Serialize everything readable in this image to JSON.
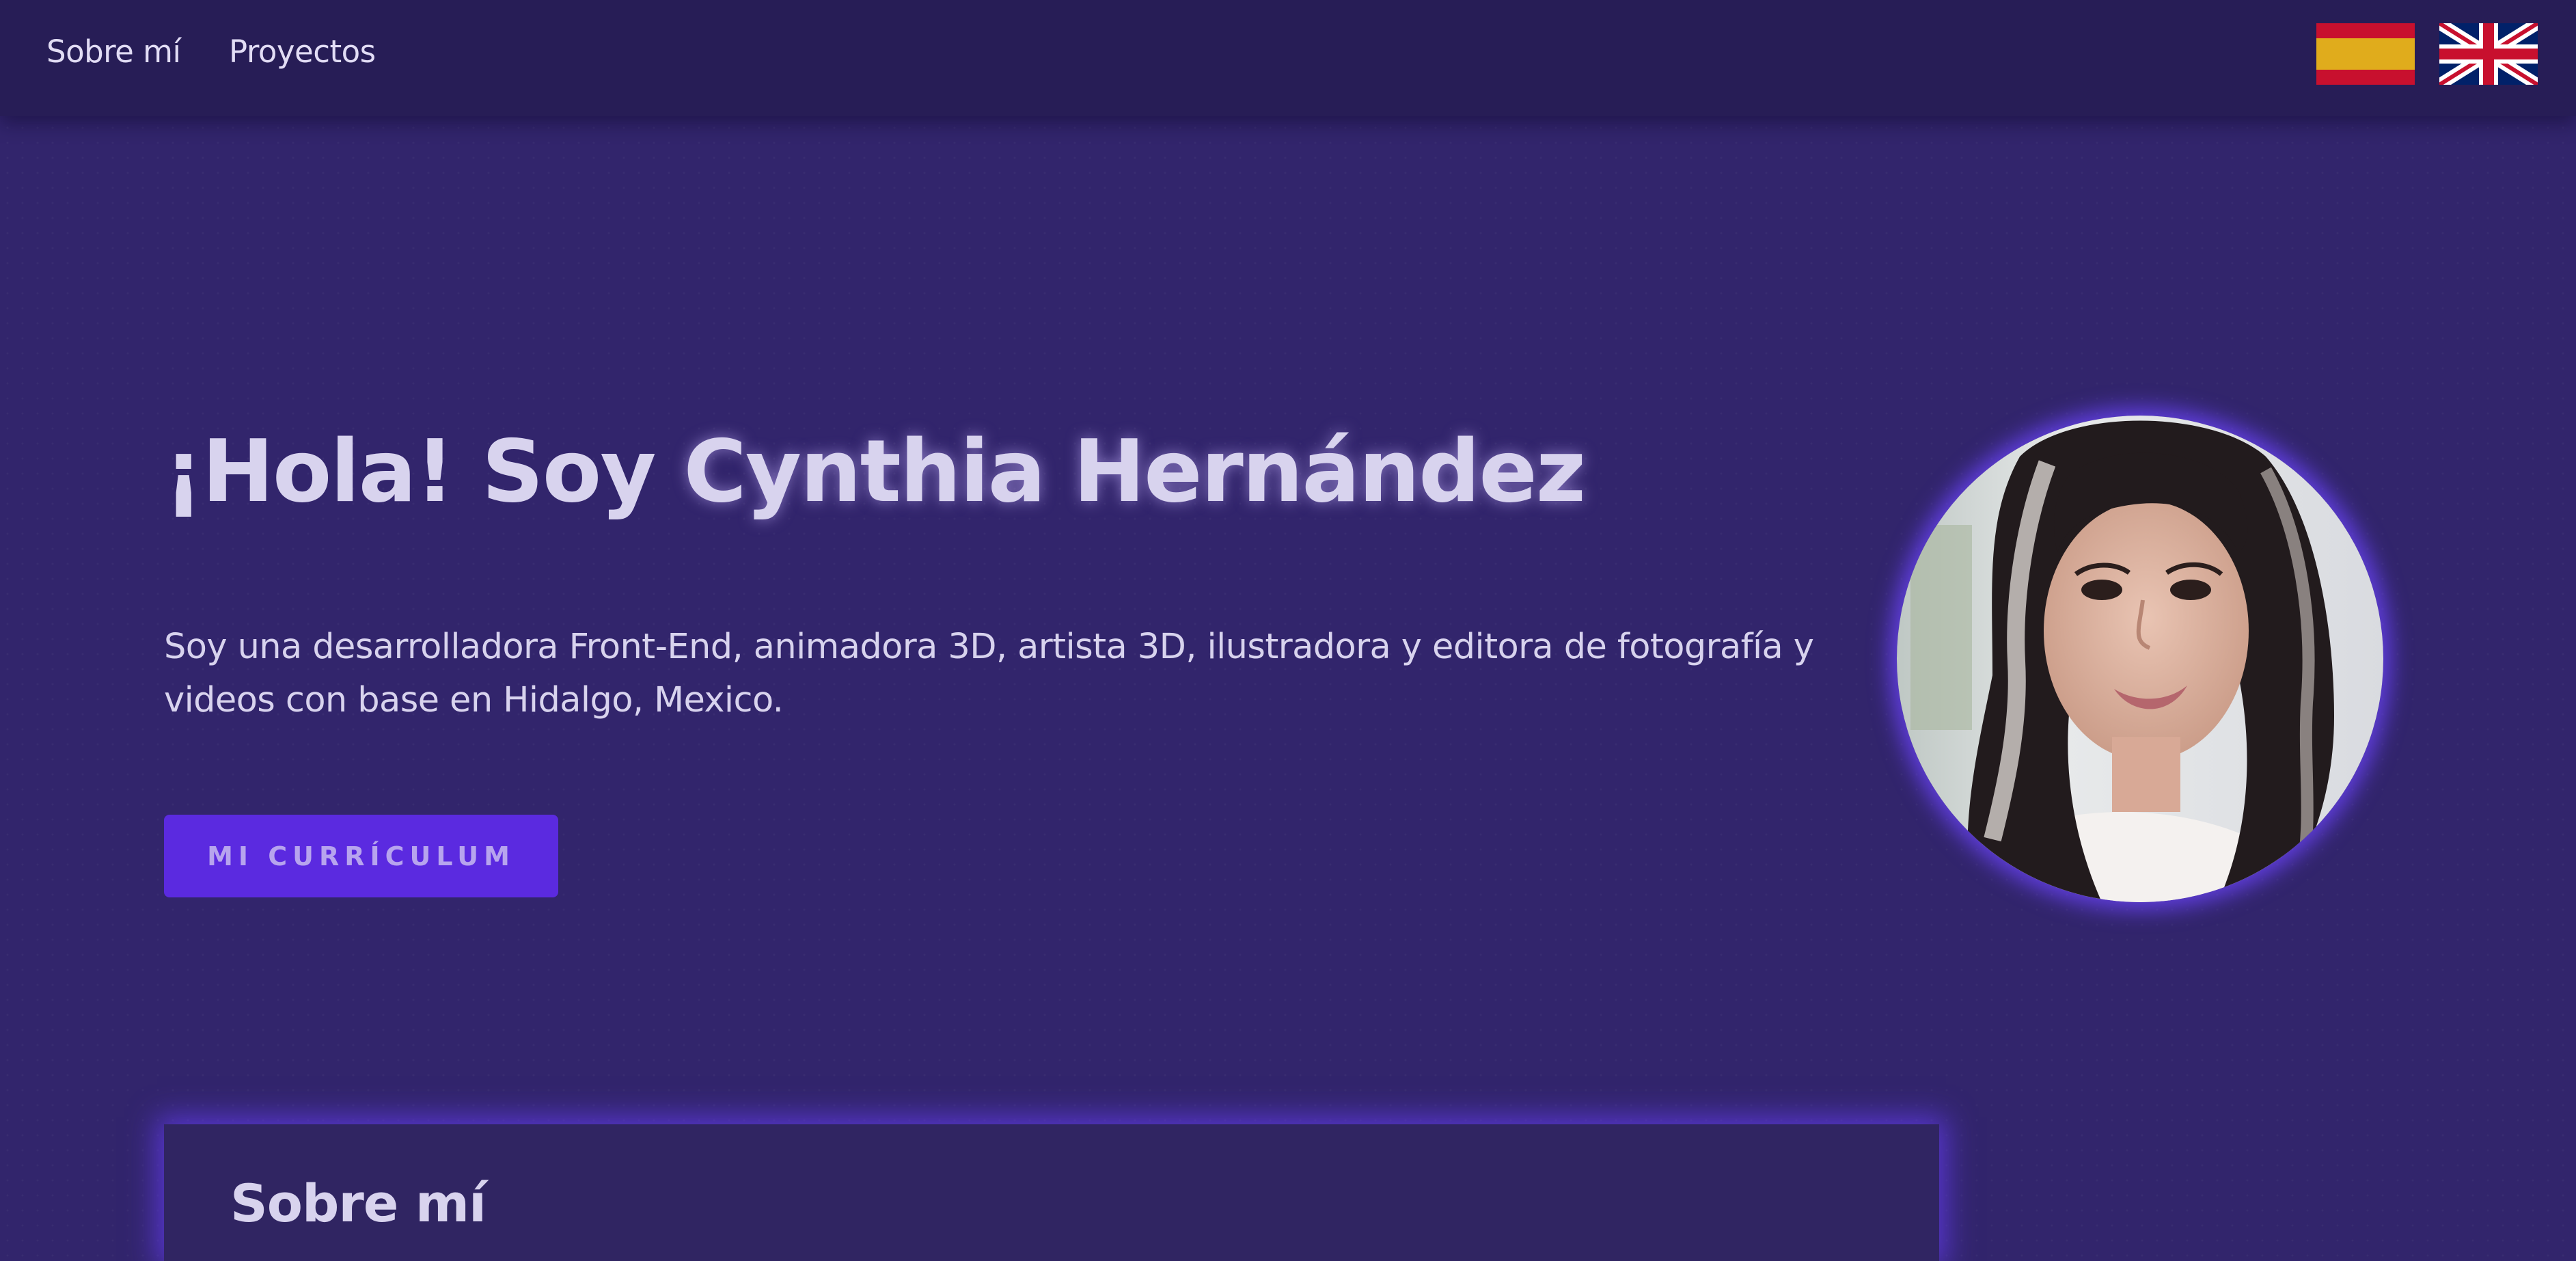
{
  "nav": {
    "links": [
      "Sobre mí",
      "Proyectos"
    ],
    "flags": [
      {
        "name": "spain-flag",
        "colors": [
          "#c8102e",
          "#e0ac1c"
        ]
      },
      {
        "name": "uk-flag",
        "colors": [
          "#012169",
          "#ffffff",
          "#c8102e"
        ]
      }
    ]
  },
  "hero": {
    "greeting": "¡Hola! Soy",
    "name": "Cynthia Hernández",
    "description": "Soy una desarrolladora Front-End, animadora 3D, artista 3D, ilustradora y editora de fotografía y videos con base en Hidalgo, Mexico.",
    "cta_label": "MI CURRÍCULUM",
    "avatar": "profile-photo"
  },
  "about": {
    "title": "Sobre mí"
  },
  "colors": {
    "background": "#32256c",
    "navbar": "#271d56",
    "accent": "#5b2ae0",
    "text": "#d8d3ee",
    "glow": "#6e46ff"
  }
}
